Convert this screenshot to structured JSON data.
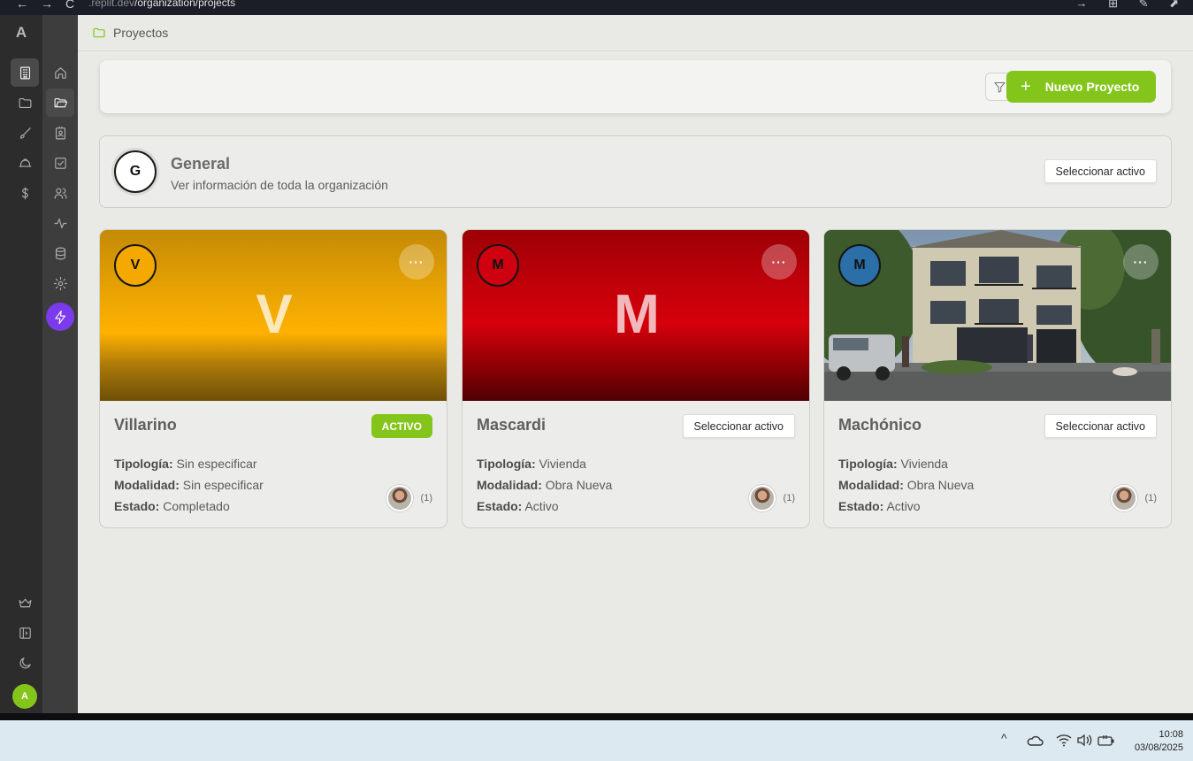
{
  "browser": {
    "url_host": ".replit.dev",
    "url_path": "/organization/projects",
    "back_glyph": "←",
    "forward_glyph": "→",
    "reload_glyph": "C",
    "right_icons": "→ ⊞ ✎ ⬈"
  },
  "app_logo": "A",
  "rail_primary": {
    "items": [
      {
        "name": "organization-icon",
        "active": true
      },
      {
        "name": "folder-icon",
        "active": false
      },
      {
        "name": "brush-icon",
        "active": false
      },
      {
        "name": "hardhat-icon",
        "active": false
      },
      {
        "name": "dollar-icon",
        "active": false
      }
    ],
    "bottom": [
      "crown-icon",
      "sidebar-toggle-icon",
      "moon-icon"
    ],
    "user_initial": "A"
  },
  "rail_secondary": {
    "items": [
      {
        "name": "home-icon",
        "active": false
      },
      {
        "name": "folder-open-icon",
        "active": true
      },
      {
        "name": "contacts-icon",
        "active": false
      },
      {
        "name": "tasks-icon",
        "active": false
      },
      {
        "name": "users-icon",
        "active": false
      },
      {
        "name": "activity-icon",
        "active": false
      },
      {
        "name": "database-icon",
        "active": false
      },
      {
        "name": "settings-icon",
        "active": false
      },
      {
        "name": "bolt-icon",
        "active": false
      }
    ]
  },
  "breadcrumb": {
    "label": "Proyectos",
    "icon": "folder-icon"
  },
  "toolbar": {
    "new_project_label": "Nuevo Proyecto",
    "plus": "+",
    "filter_icon": "filter-icon"
  },
  "general": {
    "initial": "G",
    "title": "General",
    "subtitle": "Ver información de toda la organización",
    "select_label": "Seleccionar activo"
  },
  "projects": [
    {
      "initial": "V",
      "big_letter": "V",
      "title": "Villarino",
      "status_badge": "ACTIVO",
      "more": "···",
      "fields": {
        "tipologia_label": "Tipología:",
        "tipologia": "Sin especificar",
        "modalidad_label": "Modalidad:",
        "modalidad": "Sin especificar",
        "estado_label": "Estado:",
        "estado": "Completado"
      },
      "member_count": "(1)",
      "color": "#f2a500"
    },
    {
      "initial": "M",
      "big_letter": "M",
      "title": "Mascardi",
      "select_label": "Seleccionar activo",
      "more": "···",
      "fields": {
        "tipologia_label": "Tipología:",
        "tipologia": "Vivienda",
        "modalidad_label": "Modalidad:",
        "modalidad": "Obra Nueva",
        "estado_label": "Estado:",
        "estado": "Activo"
      },
      "member_count": "(1)",
      "color": "#c8000a"
    },
    {
      "initial": "M",
      "title": "Machónico",
      "select_label": "Seleccionar activo",
      "more": "···",
      "fields": {
        "tipologia_label": "Tipología:",
        "tipologia": "Vivienda",
        "modalidad_label": "Modalidad:",
        "modalidad": "Obra Nueva",
        "estado_label": "Estado:",
        "estado": "Activo"
      },
      "member_count": "(1)",
      "color": "#2a6fa8"
    }
  ],
  "taskbar": {
    "time": "10:08",
    "date": "03/08/2025",
    "chevron": "^"
  },
  "colors": {
    "accent": "#84c51b",
    "purple": "#7c3aed"
  }
}
